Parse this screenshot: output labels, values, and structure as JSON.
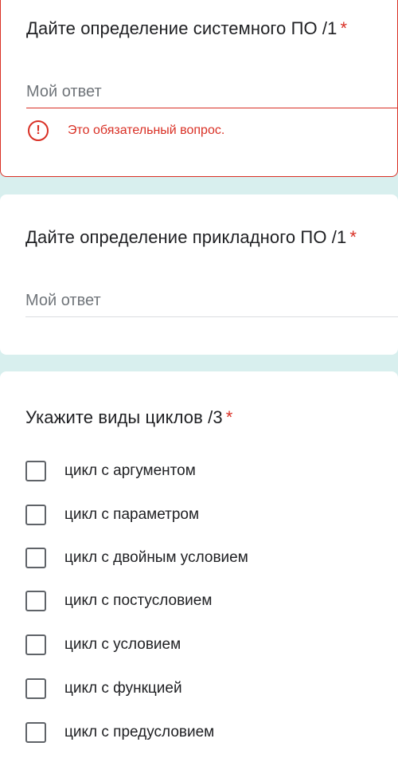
{
  "colors": {
    "accent_bg": "#d8efee",
    "error": "#d93025",
    "text": "#202124",
    "muted": "#70757a"
  },
  "questions": [
    {
      "title": "Дайте определение системного ПО /1",
      "required_mark": "*",
      "answer_placeholder": "Мой ответ",
      "error_icon": "exclamation-circle-icon",
      "error_icon_glyph": "!",
      "error_text": "Это обязательный вопрос."
    },
    {
      "title": "Дайте определение прикладного ПО /1",
      "required_mark": "*",
      "answer_placeholder": "Мой ответ"
    },
    {
      "title": "Укажите виды циклов /3",
      "required_mark": "*",
      "options": [
        {
          "label": "цикл с аргументом",
          "checked": false
        },
        {
          "label": "цикл с параметром",
          "checked": false
        },
        {
          "label": "цикл с двойным условием",
          "checked": false
        },
        {
          "label": "цикл с постусловием",
          "checked": false
        },
        {
          "label": "цикл с условием",
          "checked": false
        },
        {
          "label": "цикл с функцией",
          "checked": false
        },
        {
          "label": "цикл с предусловием",
          "checked": false
        }
      ]
    }
  ]
}
